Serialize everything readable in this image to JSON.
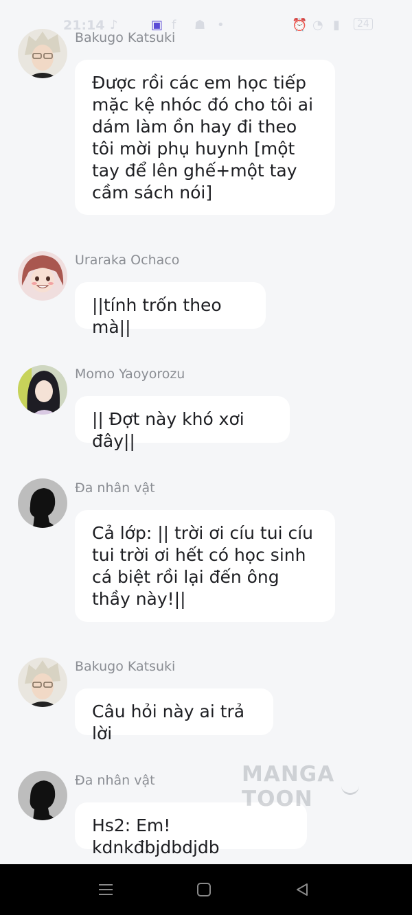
{
  "status_bar": {
    "time": "21:14",
    "battery": "24"
  },
  "messages": [
    {
      "sender": "Bakugo Katsuki",
      "avatar": "bakugo-avatar",
      "text": "Được rồi các em học tiếp mặc kệ nhóc đó cho tôi ai dám làm ồn hay đi theo tôi mời phụ huynh [một tay để lên ghế+một tay cầm sách nói]"
    },
    {
      "sender": "Uraraka Ochaco",
      "avatar": "uraraka-avatar",
      "text": "||tính trốn theo mà||"
    },
    {
      "sender": "Momo Yaoyorozu",
      "avatar": "momo-avatar",
      "text": "|| Đợt này khó xơi đây||"
    },
    {
      "sender": "Đa nhân vật",
      "avatar": "silhouette-avatar",
      "text": "Cả lớp: || trời ơi cíu tui cíu tui trời ơi hết có học sinh cá biệt rồi lại đến ông thầy này!||"
    },
    {
      "sender": "Bakugo Katsuki",
      "avatar": "bakugo-avatar",
      "text": "Câu hỏi này ai trả lời"
    },
    {
      "sender": "Đa nhân vật",
      "avatar": "silhouette-avatar",
      "text": "Hs2: Em! kdnkđbjdbdjdb"
    }
  ],
  "watermark": "MANGA TOON",
  "nav": {
    "items": [
      "menu-icon",
      "home-icon",
      "back-icon"
    ]
  }
}
